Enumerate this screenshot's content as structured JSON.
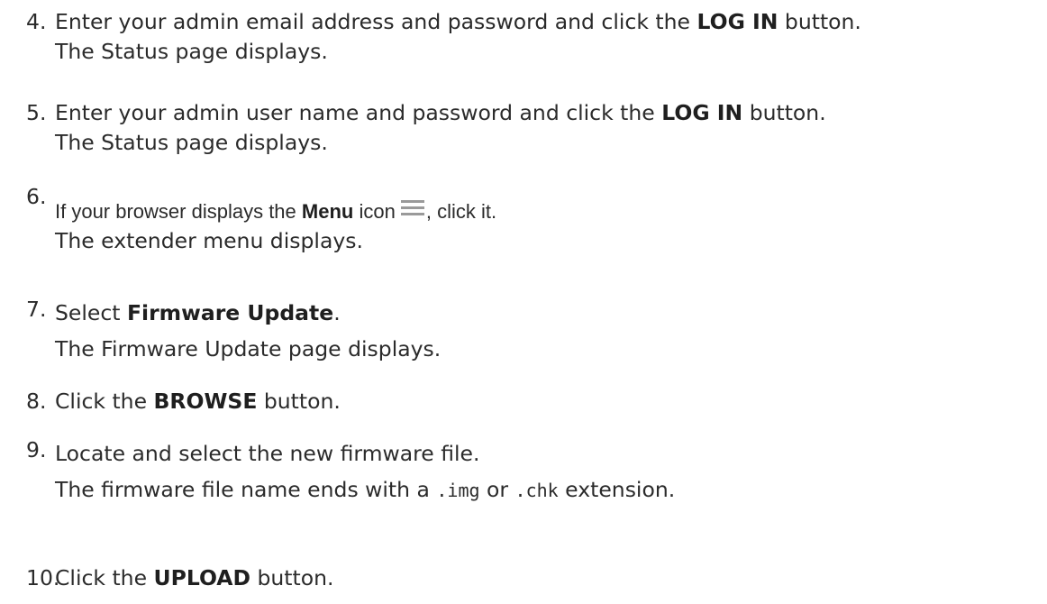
{
  "steps": [
    {
      "number": "4.",
      "line1_pre": "Enter your admin email address and password and click the ",
      "line1_bold": "LOG IN",
      "line1_post": " button.",
      "line2": "The Status page displays."
    },
    {
      "number": "5.",
      "line1_pre": "Enter your admin user name and password and click the ",
      "line1_bold": "LOG IN",
      "line1_post": " button.",
      "line2": "The Status page displays."
    },
    {
      "number": "6.",
      "line1_pre": "If your browser displays the ",
      "line1_bold": "Menu",
      "line1_mid": " icon",
      "line1_post": ", click it.",
      "icon": "hamburger-menu-icon",
      "line2": "The extender menu displays."
    },
    {
      "number": "7.",
      "line1_pre": "Select ",
      "line1_bold": "Firmware Update",
      "line1_post": ".",
      "line2": "The Firmware Update page displays."
    },
    {
      "number": "8.",
      "line1_pre": "Click the ",
      "line1_bold": "BROWSE",
      "line1_post": " button."
    },
    {
      "number": "9.",
      "line1": "Locate and select the new firmware file.",
      "line2_pre": "The firmware file name ends with a ",
      "line2_code1": ".img",
      "line2_mid": " or ",
      "line2_code2": ".chk",
      "line2_post": " extension."
    },
    {
      "number": "10.",
      "line1_pre": "Click the ",
      "line1_bold": "UPLOAD",
      "line1_post": " button."
    }
  ],
  "colors": {
    "text": "#2b2b2b",
    "icon": "#9a9a9a"
  }
}
